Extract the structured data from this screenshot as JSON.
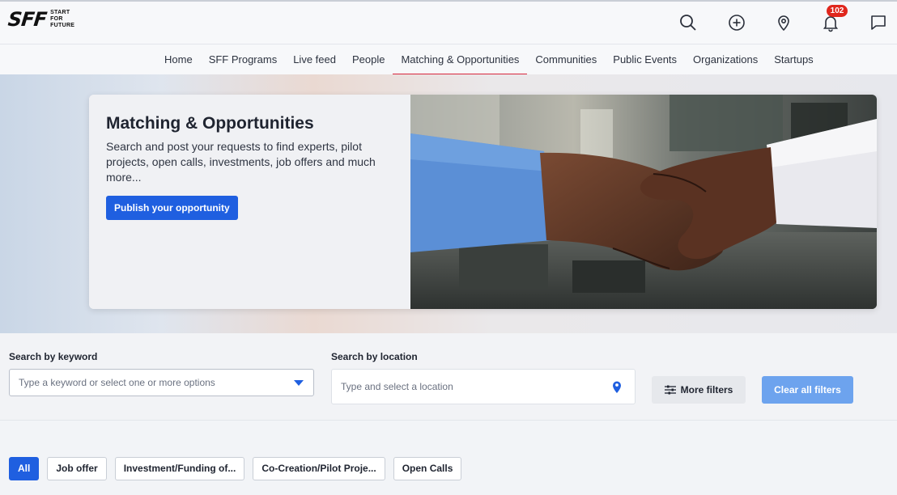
{
  "logo": {
    "mark": "SFF",
    "line1": "START",
    "line2": "FOR",
    "line3": "FUTURE"
  },
  "header": {
    "icons": [
      "search-icon",
      "plus-circle-icon",
      "location-pin-icon",
      "bell-icon",
      "chat-icon"
    ],
    "notification_count": "102"
  },
  "nav": {
    "items": [
      {
        "label": "Home"
      },
      {
        "label": "SFF Programs"
      },
      {
        "label": "Live feed"
      },
      {
        "label": "People"
      },
      {
        "label": "Matching & Opportunities",
        "active": true
      },
      {
        "label": "Communities"
      },
      {
        "label": "Public Events"
      },
      {
        "label": "Organizations"
      },
      {
        "label": "Startups"
      }
    ],
    "active_color": "#d7263d"
  },
  "hero": {
    "title": "Matching & Opportunities",
    "description": "Search and post your requests to find experts, pilot projects, open calls, investments, job offers and much more...",
    "cta": "Publish your opportunity",
    "image": "handshake-photo"
  },
  "filters": {
    "keyword_label": "Search by keyword",
    "keyword_placeholder": "Type a keyword or select one or more options",
    "location_label": "Search by location",
    "location_placeholder": "Type and select a location",
    "more_filters": "More filters",
    "clear_all": "Clear all filters"
  },
  "chips": [
    {
      "label": "All",
      "active": true
    },
    {
      "label": "Job offer"
    },
    {
      "label": "Investment/Funding of..."
    },
    {
      "label": "Co-Creation/Pilot Proje..."
    },
    {
      "label": "Open Calls"
    }
  ],
  "colors": {
    "primary": "#1f5fe0",
    "primary_light": "#6da3ee",
    "badge": "#e0271d"
  }
}
